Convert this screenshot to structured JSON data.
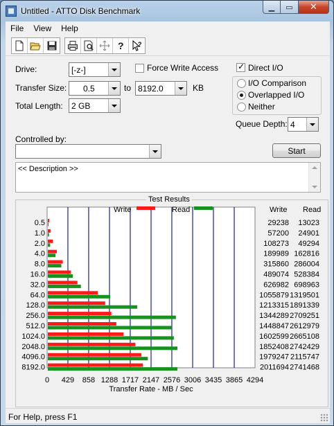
{
  "window": {
    "title": "Untitled - ATTO Disk Benchmark"
  },
  "menu": [
    "File",
    "View",
    "Help"
  ],
  "toolbar": {
    "icons": [
      "new-icon",
      "open-icon",
      "save-icon",
      "print-icon",
      "print-preview-icon",
      "move-icon",
      "help-icon",
      "context-help-icon"
    ]
  },
  "form": {
    "drive_label": "Drive:",
    "drive_value": "[-z-]",
    "force_write_label": "Force Write Access",
    "force_write_checked": false,
    "direct_io_label": "Direct I/O",
    "direct_io_checked": true,
    "transfer_size_label": "Transfer Size:",
    "transfer_from": "0.5",
    "to_label": "to",
    "transfer_to": "8192.0",
    "kb_label": "KB",
    "total_length_label": "Total Length:",
    "total_length_value": "2 GB",
    "io_options": [
      "I/O Comparison",
      "Overlapped I/O",
      "Neither"
    ],
    "io_selected": "Overlapped I/O",
    "queue_depth_label": "Queue Depth:",
    "queue_depth_value": "4",
    "controlled_by_label": "Controlled by:",
    "controlled_by_value": "",
    "start_label": "Start",
    "description": "<< Description >>"
  },
  "results": {
    "title": "Test Results",
    "write_col": "Write",
    "read_col": "Read",
    "rows": [
      {
        "size": "0.5",
        "write": "29238",
        "read": "13023"
      },
      {
        "size": "1.0",
        "write": "57200",
        "read": "24901"
      },
      {
        "size": "2.0",
        "write": "108273",
        "read": "49294"
      },
      {
        "size": "4.0",
        "write": "189989",
        "read": "162816"
      },
      {
        "size": "8.0",
        "write": "315860",
        "read": "286004"
      },
      {
        "size": "16.0",
        "write": "489074",
        "read": "528384"
      },
      {
        "size": "32.0",
        "write": "626982",
        "read": "698963"
      },
      {
        "size": "64.0",
        "write": "1055879",
        "read": "1319501"
      },
      {
        "size": "128.0",
        "write": "1213315",
        "read": "1891339"
      },
      {
        "size": "256.0",
        "write": "1344289",
        "read": "2709251"
      },
      {
        "size": "512.0",
        "write": "1448847",
        "read": "2612979"
      },
      {
        "size": "1024.0",
        "write": "1602599",
        "read": "2665108"
      },
      {
        "size": "2048.0",
        "write": "1852408",
        "read": "2742429"
      },
      {
        "size": "4096.0",
        "write": "1979247",
        "read": "2115747"
      },
      {
        "size": "8192.0",
        "write": "2011694",
        "read": "2741468"
      }
    ]
  },
  "chart_data": {
    "type": "bar",
    "title": "",
    "xlabel": "Transfer Rate - MB / Sec",
    "ylabel": "",
    "categories": [
      "0.5",
      "1.0",
      "2.0",
      "4.0",
      "8.0",
      "16.0",
      "32.0",
      "64.0",
      "128.0",
      "256.0",
      "512.0",
      "1024.0",
      "2048.0",
      "4096.0",
      "8192.0"
    ],
    "series": [
      {
        "name": "Write",
        "color": "#ff1a1a",
        "values": [
          28.6,
          55.9,
          105.7,
          185.5,
          308.5,
          477.6,
          612.3,
          1031.1,
          1184.9,
          1312.8,
          1414.9,
          1565.0,
          1809.0,
          1932.9,
          1964.5
        ]
      },
      {
        "name": "Read",
        "color": "#17921f",
        "values": [
          12.7,
          24.3,
          48.1,
          159.0,
          279.3,
          516.0,
          682.6,
          1288.6,
          1847.0,
          2645.8,
          2551.7,
          2602.6,
          2678.2,
          2066.2,
          2677.2
        ]
      }
    ],
    "x_ticks": [
      "0",
      "429",
      "858",
      "1288",
      "1717",
      "2147",
      "2576",
      "3006",
      "3435",
      "3865",
      "4294"
    ],
    "xlim": [
      0,
      4294
    ],
    "grid": true,
    "legend": "top"
  },
  "status": {
    "text": "For Help, press F1"
  },
  "colors": {
    "write": "#ff1a1a",
    "read": "#17921f",
    "grid": "#1a1aa8"
  }
}
